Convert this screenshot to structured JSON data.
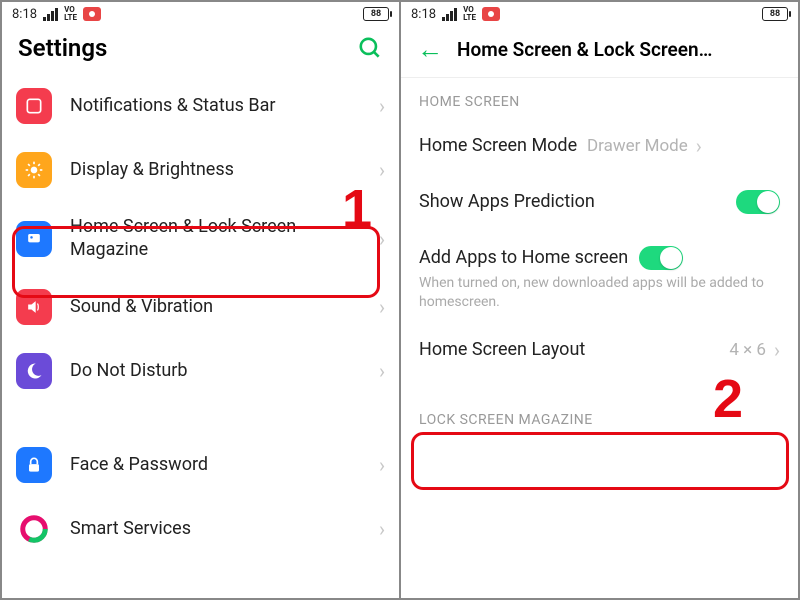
{
  "statusbar": {
    "time": "8:18",
    "battery": "88"
  },
  "left": {
    "title": "Settings",
    "items": [
      {
        "label": "Notifications & Status Bar"
      },
      {
        "label": "Display & Brightness"
      },
      {
        "label": "Home Screen & Lock Screen Magazine"
      },
      {
        "label": "Sound & Vibration"
      },
      {
        "label": "Do Not Disturb"
      },
      {
        "label": "Face & Password"
      },
      {
        "label": "Smart Services"
      }
    ]
  },
  "right": {
    "title": "Home Screen & Lock Screen…",
    "section1": "HOME SCREEN",
    "section2": "LOCK SCREEN MAGAZINE",
    "mode": {
      "label": "Home Screen Mode",
      "value": "Drawer Mode"
    },
    "prediction_label": "Show Apps Prediction",
    "addapps": {
      "label": "Add Apps to Home screen",
      "desc": "When turned on, new downloaded apps will be added to homescreen."
    },
    "layout": {
      "label": "Home Screen Layout",
      "value": "4 × 6"
    }
  },
  "steps": {
    "one": "1",
    "two": "2"
  }
}
